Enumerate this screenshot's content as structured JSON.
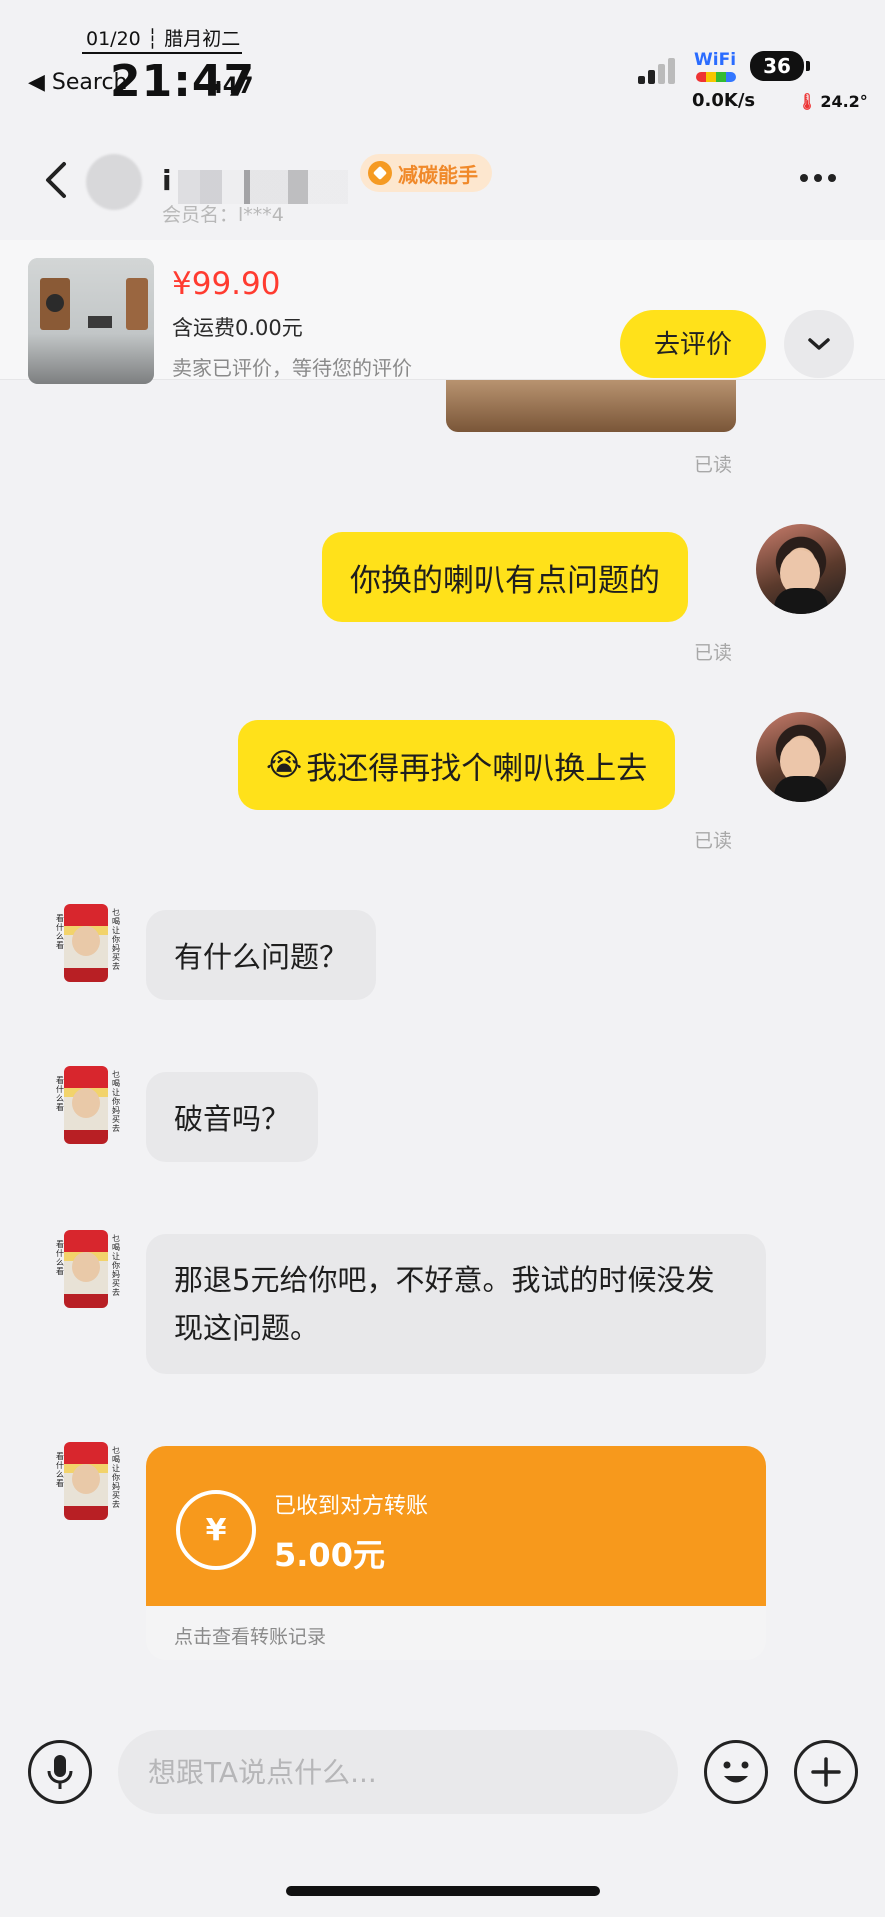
{
  "status_bar": {
    "date": "01/20 ┆ 腊月初二",
    "back_label": "◀ Search",
    "time": "21:47",
    "seconds": ":47",
    "wifi_label": "WiFi",
    "battery": "36",
    "net_speed": "0.0K/s",
    "temperature": "24.2°"
  },
  "header": {
    "name_prefix": "i",
    "badge_label": "减碳能手",
    "member_label": "会员名：l***4"
  },
  "order": {
    "price": "¥99.90",
    "shipping": "含运费0.00元",
    "review_status": "卖家已评价，等待您的评价",
    "review_button": "去评价"
  },
  "messages": [
    {
      "from": "me",
      "text": "你换的喇叭有点问题的",
      "status": "已读"
    },
    {
      "from": "me",
      "emoji": "😭",
      "text": "我还得再找个喇叭换上去",
      "status": "已读"
    },
    {
      "from": "them",
      "text": "有什么问题？"
    },
    {
      "from": "them",
      "text": "破音吗？"
    },
    {
      "from": "them",
      "text": "那退5元给你吧，不好意。我试的时候没发现这问题。"
    }
  ],
  "first_read": "已读",
  "transfer": {
    "title": "已收到对方转账",
    "amount": "5.00元",
    "footer": "点击查看转账记录"
  },
  "seller_avatar": {
    "left_text": "看什么看",
    "right_text": "乜喝让你妈买去"
  },
  "input": {
    "placeholder": "想跟TA说点什么..."
  }
}
